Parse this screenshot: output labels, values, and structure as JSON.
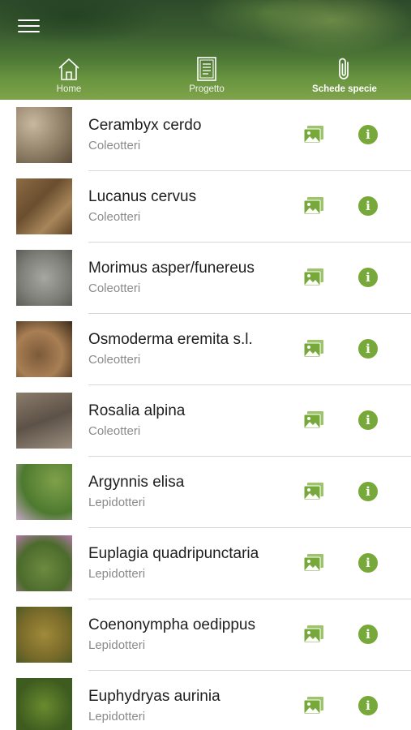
{
  "header": {
    "tabs": [
      {
        "label": "Home",
        "icon": "home-icon",
        "active": false
      },
      {
        "label": "Progetto",
        "icon": "document-icon",
        "active": false
      },
      {
        "label": "Schede specie",
        "icon": "paperclip-icon",
        "active": true
      }
    ]
  },
  "species": [
    {
      "name": "Cerambyx cerdo",
      "group": "Coleotteri"
    },
    {
      "name": "Lucanus cervus",
      "group": "Coleotteri"
    },
    {
      "name": "Morimus asper/funereus",
      "group": "Coleotteri"
    },
    {
      "name": "Osmoderma eremita s.l.",
      "group": "Coleotteri"
    },
    {
      "name": "Rosalia alpina",
      "group": "Coleotteri"
    },
    {
      "name": "Argynnis elisa",
      "group": "Lepidotteri"
    },
    {
      "name": "Euplagia quadripunctaria",
      "group": "Lepidotteri"
    },
    {
      "name": "Coenonympha oedippus",
      "group": "Lepidotteri"
    },
    {
      "name": "Euphydryas aurinia",
      "group": "Lepidotteri"
    }
  ],
  "colors": {
    "accent": "#76a83a",
    "name_text": "#1e1e1e",
    "group_text": "#8a8a8a",
    "divider": "#d9d9d9"
  },
  "icons": {
    "gallery": "gallery-icon",
    "info": "info-icon",
    "info_glyph": "i"
  }
}
